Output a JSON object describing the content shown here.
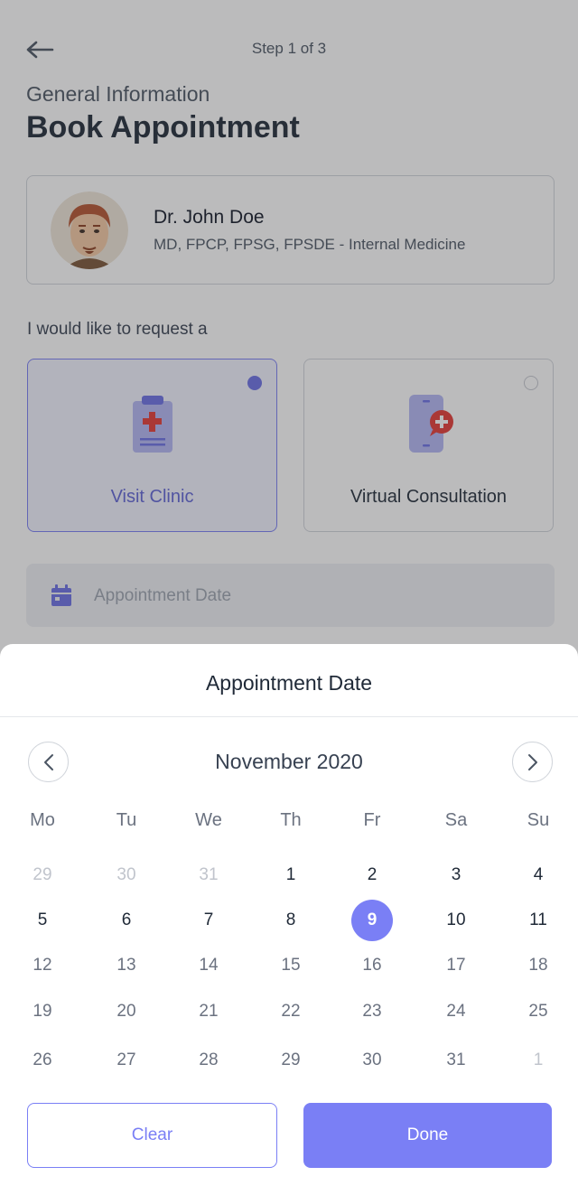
{
  "header": {
    "step": "Step 1 of 3",
    "subtitle": "General Information",
    "title": "Book Appointment"
  },
  "doctor": {
    "name": "Dr. John Doe",
    "credentials": "MD, FPCP, FPSG, FPSDE - Internal Medicine"
  },
  "request": {
    "label": "I would like to request a",
    "options": [
      {
        "label": "Visit Clinic",
        "icon": "clipboard-medical-icon",
        "selected": true
      },
      {
        "label": "Virtual Consultation",
        "icon": "phone-medical-chat-icon",
        "selected": false
      }
    ]
  },
  "date_field": {
    "placeholder": "Appointment Date",
    "icon": "calendar-icon"
  },
  "sheet": {
    "title": "Appointment Date",
    "month": "November 2020",
    "weekdays": [
      "Mo",
      "Tu",
      "We",
      "Th",
      "Fr",
      "Sa",
      "Su"
    ],
    "weeks": [
      [
        "29",
        "30",
        "31",
        "1",
        "2",
        "3",
        "4"
      ],
      [
        "5",
        "6",
        "7",
        "8",
        "9",
        "10",
        "11"
      ],
      [
        "12",
        "13",
        "14",
        "15",
        "16",
        "17",
        "18"
      ],
      [
        "19",
        "20",
        "21",
        "22",
        "23",
        "24",
        "25"
      ],
      [
        "26",
        "27",
        "28",
        "29",
        "30",
        "31",
        "1"
      ]
    ],
    "selected_day": "9",
    "clear_label": "Clear",
    "done_label": "Done"
  },
  "colors": {
    "accent": "#7a7ff5",
    "selected_option_bg": "#f2f3ff",
    "medical_red": "#e53935"
  }
}
